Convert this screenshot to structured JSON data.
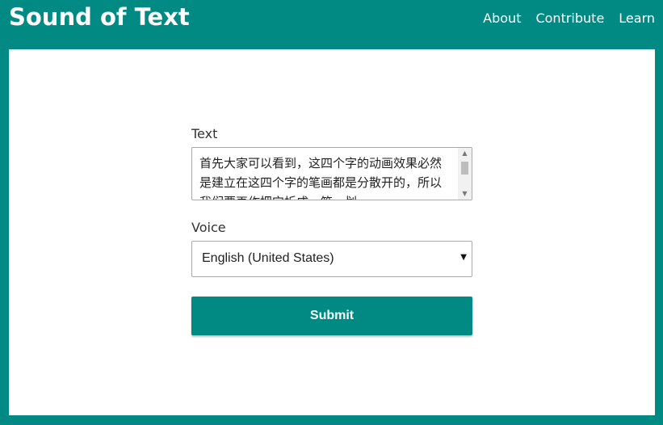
{
  "header": {
    "logo": "Sound of Text",
    "nav": [
      "About",
      "Contribute",
      "Learn"
    ]
  },
  "form": {
    "text_label": "Text",
    "text_value": "首先大家可以看到，这四个字的动画效果必然是建立在这四个字的笔画都是分散开的，所以我们要再作把它拆成一笔一划。",
    "voice_label": "Voice",
    "voice_value": "English (United States)",
    "submit_label": "Submit"
  },
  "colors": {
    "brand": "#008a83",
    "card": "#ffffff"
  }
}
